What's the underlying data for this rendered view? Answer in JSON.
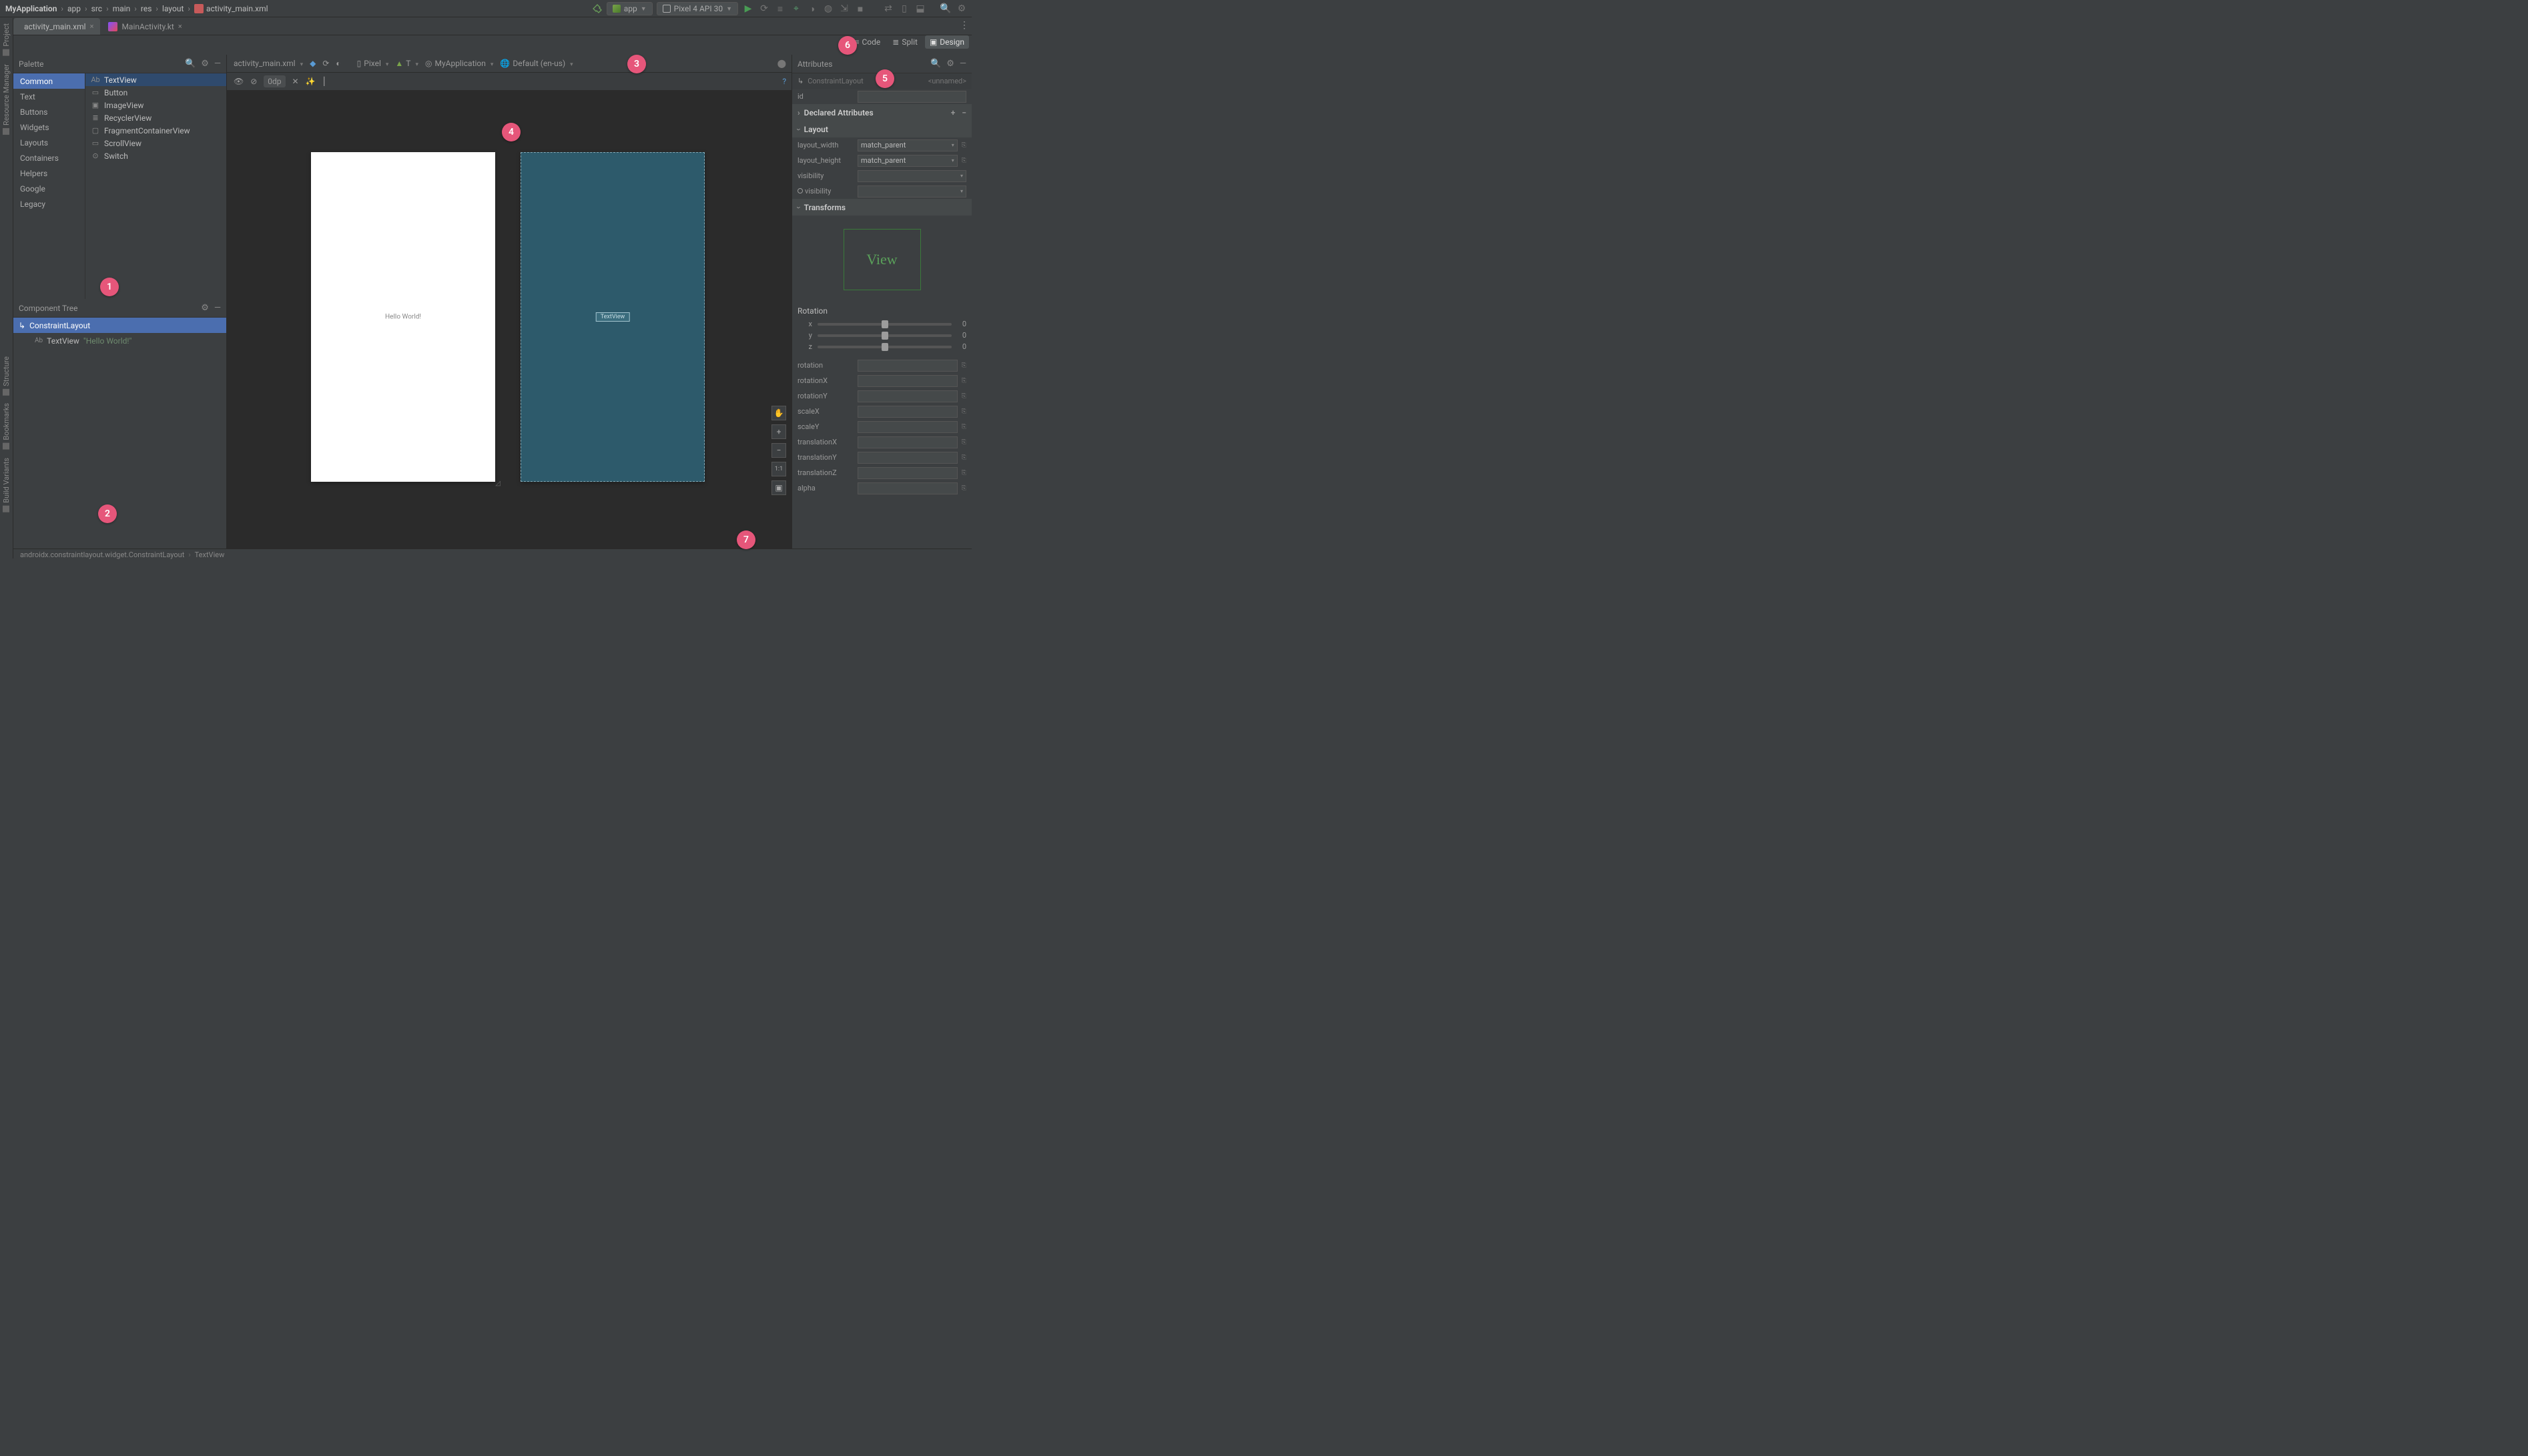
{
  "breadcrumb": {
    "project": "MyApplication",
    "parts": [
      "app",
      "src",
      "main",
      "res",
      "layout",
      "activity_main.xml"
    ]
  },
  "run": {
    "config": "app",
    "device": "Pixel 4 API 30"
  },
  "tabs": [
    {
      "label": "activity_main.xml",
      "kind": "xml"
    },
    {
      "label": "MainActivity.kt",
      "kind": "kt"
    }
  ],
  "viewmode": {
    "code": "Code",
    "split": "Split",
    "design": "Design"
  },
  "sidebar": {
    "project": "Project",
    "resource_manager": "Resource Manager",
    "structure": "Structure",
    "bookmarks": "Bookmarks",
    "build_variants": "Build Variants"
  },
  "palette": {
    "title": "Palette",
    "categories": [
      "Common",
      "Text",
      "Buttons",
      "Widgets",
      "Layouts",
      "Containers",
      "Helpers",
      "Google",
      "Legacy"
    ],
    "items": [
      "TextView",
      "Button",
      "ImageView",
      "RecyclerView",
      "FragmentContainerView",
      "ScrollView",
      "Switch"
    ],
    "item_icons": [
      "Ab",
      "▭",
      "▣",
      "≣",
      "▢",
      "▭",
      "⊙"
    ]
  },
  "component_tree": {
    "title": "Component Tree",
    "root": "ConstraintLayout",
    "child": "TextView",
    "child_text": "\"Hello World!\""
  },
  "design_toolbar": {
    "file": "activity_main.xml",
    "device": "Pixel",
    "theme": "T",
    "app": "MyApplication",
    "locale": "Default (en-us)"
  },
  "design_toolbar2": {
    "margin": "0dp"
  },
  "canvas": {
    "hello": "Hello World!",
    "tv": "TextView"
  },
  "zoom": {
    "pan": "✋",
    "plus": "+",
    "minus": "−",
    "fit": "1:1",
    "full": "▣"
  },
  "attributes": {
    "title": "Attributes",
    "comp": "ConstraintLayout",
    "unnamed": "<unnamed>",
    "id_label": "id",
    "declared": "Declared Attributes",
    "layout": "Layout",
    "layout_width_label": "layout_width",
    "layout_width": "match_parent",
    "layout_height_label": "layout_height",
    "layout_height": "match_parent",
    "visibility_label": "visibility",
    "tools_visibility_label": "visibility",
    "transforms": "Transforms",
    "view": "View",
    "rotation_title": "Rotation",
    "sliders": [
      {
        "label": "x",
        "val": "0"
      },
      {
        "label": "y",
        "val": "0"
      },
      {
        "label": "z",
        "val": "0"
      }
    ],
    "fields": [
      "rotation",
      "rotationX",
      "rotationY",
      "scaleX",
      "scaleY",
      "translationX",
      "translationY",
      "translationZ",
      "alpha"
    ]
  },
  "status": {
    "path": "androidx.constraintlayout.widget.ConstraintLayout",
    "leaf": "TextView"
  },
  "callouts": [
    "1",
    "2",
    "3",
    "4",
    "5",
    "6",
    "7"
  ]
}
